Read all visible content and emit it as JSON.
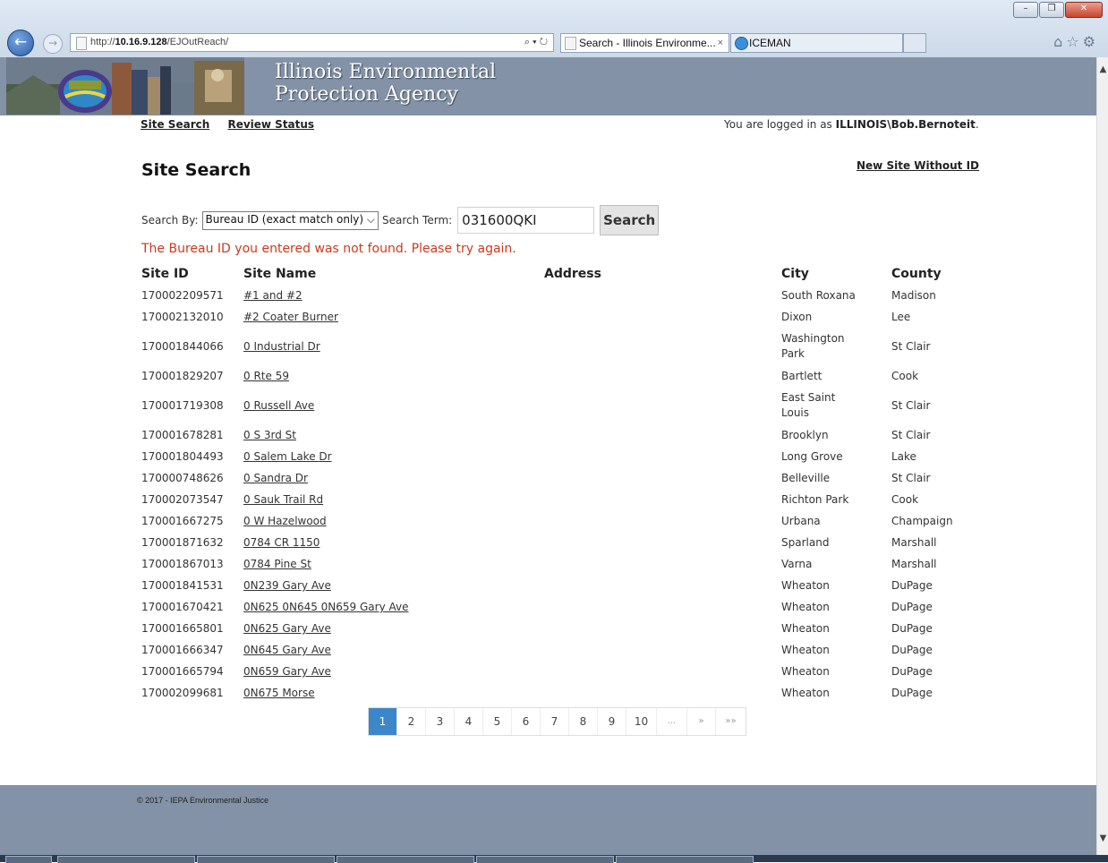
{
  "browser": {
    "url_prefix": "http://",
    "url_host": "10.16.9.128",
    "url_path": "/EJOutReach/",
    "address_tools": "⌕ ▾ ↻",
    "tabs": [
      {
        "label": "Search - Illinois Environme...",
        "close": "×"
      },
      {
        "label": "ICEMAN"
      }
    ]
  },
  "header": {
    "agency_line1": "Illinois Environmental",
    "agency_line2": "Protection Agency"
  },
  "nav": {
    "site_search": "Site Search",
    "review_status": "Review Status"
  },
  "login": {
    "prefix": "You are logged in as ",
    "user": "ILLINOIS\\Bob.Bernoteit",
    "suffix": "."
  },
  "page": {
    "title": "Site Search",
    "new_site_link": "New Site Without ID"
  },
  "search": {
    "search_by_label": "Search By:",
    "search_by_value": "Bureau ID (exact match only)",
    "term_label": "Search Term:",
    "term_value": "031600QKI",
    "button_label": "Search",
    "error": "The Bureau ID you entered was not found. Please try again."
  },
  "table": {
    "headers": {
      "site_id": "Site ID",
      "site_name": "Site Name",
      "address": "Address",
      "city": "City",
      "county": "County"
    },
    "rows": [
      {
        "id": "170002209571",
        "name": "#1 and #2",
        "address": "",
        "city": "South Roxana",
        "county": "Madison"
      },
      {
        "id": "170002132010",
        "name": "#2 Coater Burner",
        "address": "",
        "city": "Dixon",
        "county": "Lee"
      },
      {
        "id": "170001844066",
        "name": "0 Industrial Dr",
        "address": "",
        "city": "Washington Park",
        "county": "St Clair"
      },
      {
        "id": "170001829207",
        "name": "0 Rte 59",
        "address": "",
        "city": "Bartlett",
        "county": "Cook"
      },
      {
        "id": "170001719308",
        "name": "0 Russell Ave",
        "address": "",
        "city": "East Saint Louis",
        "county": "St Clair"
      },
      {
        "id": "170001678281",
        "name": "0 S 3rd St",
        "address": "",
        "city": "Brooklyn",
        "county": "St Clair"
      },
      {
        "id": "170001804493",
        "name": "0 Salem Lake Dr",
        "address": "",
        "city": "Long Grove",
        "county": "Lake"
      },
      {
        "id": "170000748626",
        "name": "0 Sandra Dr",
        "address": "",
        "city": "Belleville",
        "county": "St Clair"
      },
      {
        "id": "170002073547",
        "name": "0 Sauk Trail Rd",
        "address": "",
        "city": "Richton Park",
        "county": "Cook"
      },
      {
        "id": "170001667275",
        "name": "0 W Hazelwood",
        "address": "",
        "city": "Urbana",
        "county": "Champaign"
      },
      {
        "id": "170001871632",
        "name": "0784 CR 1150",
        "address": "",
        "city": "Sparland",
        "county": "Marshall"
      },
      {
        "id": "170001867013",
        "name": "0784 Pine St",
        "address": "",
        "city": "Varna",
        "county": "Marshall"
      },
      {
        "id": "170001841531",
        "name": "0N239 Gary Ave",
        "address": "",
        "city": "Wheaton",
        "county": "DuPage"
      },
      {
        "id": "170001670421",
        "name": "0N625 0N645 0N659 Gary Ave",
        "address": "",
        "city": "Wheaton",
        "county": "DuPage"
      },
      {
        "id": "170001665801",
        "name": "0N625 Gary Ave",
        "address": "",
        "city": "Wheaton",
        "county": "DuPage"
      },
      {
        "id": "170001666347",
        "name": "0N645 Gary Ave",
        "address": "",
        "city": "Wheaton",
        "county": "DuPage"
      },
      {
        "id": "170001665794",
        "name": "0N659 Gary Ave",
        "address": "",
        "city": "Wheaton",
        "county": "DuPage"
      },
      {
        "id": "170002099681",
        "name": "0N675 Morse",
        "address": "",
        "city": "Wheaton",
        "county": "DuPage"
      }
    ]
  },
  "pager": {
    "pages": [
      "1",
      "2",
      "3",
      "4",
      "5",
      "6",
      "7",
      "8",
      "9",
      "10",
      "...",
      "»",
      "»»"
    ],
    "current": "1"
  },
  "footer": {
    "copyright": "© 2017 - IEPA Environmental Justice"
  },
  "colors": {
    "header_bg": "#8392a6",
    "error": "#cc3a1e",
    "pager_active": "#3c87c9"
  }
}
